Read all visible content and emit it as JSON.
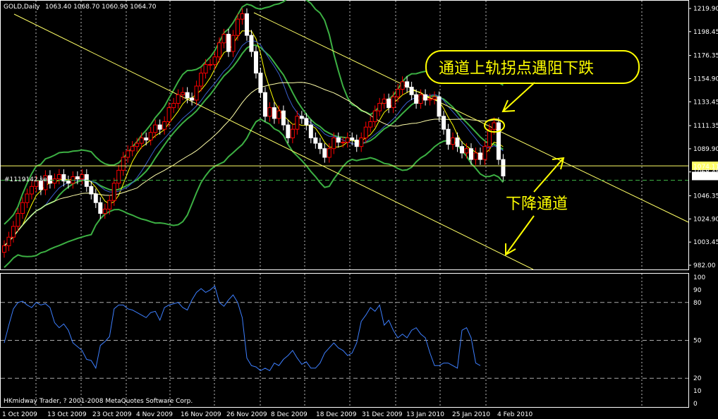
{
  "header": {
    "symbol": "GOLD,Daily",
    "ohlc": "1063.40 1068.70 1060.90 1064.70"
  },
  "footer": {
    "copyright": "HKmidway Trader, ? 2001-2008 MetaQuotes Software Corp."
  },
  "annotations": {
    "callout": "通道上轨拐点遇阻下跌",
    "channel": "下降通道",
    "order_label": "#1119142 sell"
  },
  "colors": {
    "background": "#000000",
    "bull_candle": "#ff0000",
    "bear_candle": "#ffffff",
    "bollinger": "#3cb043",
    "ma_fast": "#ffff00",
    "ma_slow": "#ffffaa",
    "ma_mid": "#3a5fcd",
    "trendline": "#ffff66",
    "oscillator": "#3d7fff",
    "annotation": "#ffff00"
  },
  "chart_data": {
    "type": "candlestick",
    "price_axis": {
      "ticks": [
        "1219.90",
        "1198.45",
        "1176.35",
        "1154.90",
        "1133.45",
        "1111.35",
        "1089.90",
        "1068.45",
        "1046.35",
        "1024.90",
        "1003.45",
        "982.00"
      ],
      "min": 982.0,
      "max": 1219.9
    },
    "current_price_label": "1064.70",
    "order_price_label": "1074.11",
    "date_ticks": [
      "1 Oct 2009",
      "13 Oct 2009",
      "23 Oct 2009",
      "4 Nov 2009",
      "16 Nov 2009",
      "26 Nov 2009",
      "8 Dec 2009",
      "18 Dec 2009",
      "31 Dec 2009",
      "13 Jan 2010",
      "25 Jan 2010",
      "4 Feb 2010"
    ],
    "close_approx": [
      1000,
      1008,
      1018,
      1030,
      1040,
      1048,
      1055,
      1060,
      1052,
      1065,
      1058,
      1062,
      1066,
      1060,
      1058,
      1064,
      1062,
      1066,
      1055,
      1048,
      1040,
      1030,
      1034,
      1042,
      1058,
      1070,
      1082,
      1088,
      1092,
      1095,
      1100,
      1098,
      1105,
      1112,
      1108,
      1115,
      1128,
      1132,
      1140,
      1142,
      1137,
      1135,
      1148,
      1160,
      1168,
      1168,
      1175,
      1188,
      1196,
      1180,
      1195,
      1210,
      1215,
      1195,
      1180,
      1160,
      1142,
      1120,
      1128,
      1118,
      1125,
      1112,
      1100,
      1108,
      1120,
      1118,
      1112,
      1100,
      1095,
      1090,
      1082,
      1090,
      1100,
      1096,
      1096,
      1100,
      1098,
      1092,
      1100,
      1110,
      1115,
      1125,
      1132,
      1136,
      1128,
      1138,
      1145,
      1152,
      1147,
      1140,
      1132,
      1140,
      1135,
      1136,
      1138,
      1120,
      1108,
      1094,
      1100,
      1092,
      1086,
      1090,
      1080,
      1086,
      1080,
      1092,
      1108,
      1114,
      1080,
      1064.7
    ],
    "oscillator": {
      "ticks": [
        "100",
        "90",
        "80",
        "50",
        "20",
        "10",
        "0"
      ],
      "min": 0,
      "max": 100,
      "levels": [
        80,
        50,
        20
      ],
      "values": [
        48,
        62,
        75,
        80,
        81,
        78,
        76,
        80,
        78,
        79,
        76,
        64,
        60,
        63,
        58,
        48,
        45,
        42,
        35,
        34,
        28,
        46,
        49,
        53,
        75,
        78,
        78,
        75,
        74,
        72,
        70,
        68,
        72,
        73,
        66,
        76,
        78,
        79,
        80,
        76,
        74,
        82,
        88,
        91,
        88,
        90,
        93,
        80,
        77,
        82,
        86,
        80,
        68,
        36,
        30,
        29,
        26,
        28,
        26,
        32,
        30,
        35,
        38,
        42,
        36,
        31,
        33,
        28,
        28,
        32,
        40,
        44,
        48,
        44,
        42,
        38,
        40,
        48,
        65,
        70,
        76,
        73,
        78,
        62,
        66,
        58,
        52,
        55,
        52,
        58,
        60,
        55,
        52,
        40,
        30,
        30,
        32,
        32,
        30,
        28,
        58,
        60,
        52,
        32,
        30
      ]
    }
  }
}
